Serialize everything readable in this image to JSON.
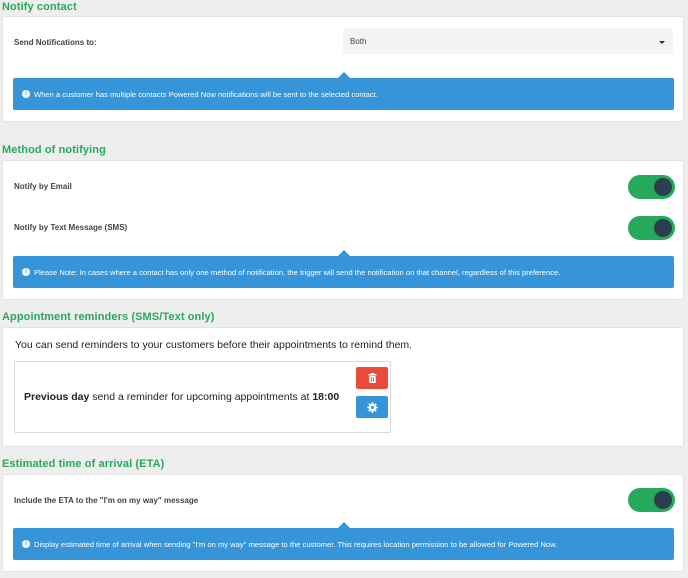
{
  "notify_contact": {
    "title": "Notify contact",
    "label": "Send Notifications to:",
    "selected": "Both",
    "info": "When a customer has multiple contacts Powered Now notifications will be sent to the selected contact."
  },
  "method": {
    "title": "Method of notifying",
    "email_label": "Notify by Email",
    "email_on": true,
    "sms_label": "Notify by Text Message (SMS)",
    "sms_on": true,
    "info": "Please Note: In cases where a contact has only one method of notification, the trigger will send the notification on that channel, regardless of this preference."
  },
  "reminders": {
    "title": "Appointment reminders (SMS/Text only)",
    "intro": "You can send reminders to your customers before their appointments to remind them.",
    "item": {
      "when": "Previous day",
      "middle": " send a reminder for upcoming appointments at ",
      "time": "18:00"
    }
  },
  "eta": {
    "title": "Estimated time of arrival (ETA)",
    "label": "Include the ETA to the \"I'm on my way\" message",
    "on": true,
    "info": "Display estimated time of arrival when sending \"I'm on my way\" message to the customer. This requires location permission to be allowed for Powered Now."
  },
  "colors": {
    "accent_green": "#27a95a",
    "info_blue": "#3595d8",
    "danger_red": "#e74c3c",
    "knob_dark": "#2c3e50"
  },
  "icons": {
    "info": "info-circle-icon",
    "delete": "trash-icon",
    "settings": "gear-icon",
    "dropdown": "caret-down-icon"
  }
}
